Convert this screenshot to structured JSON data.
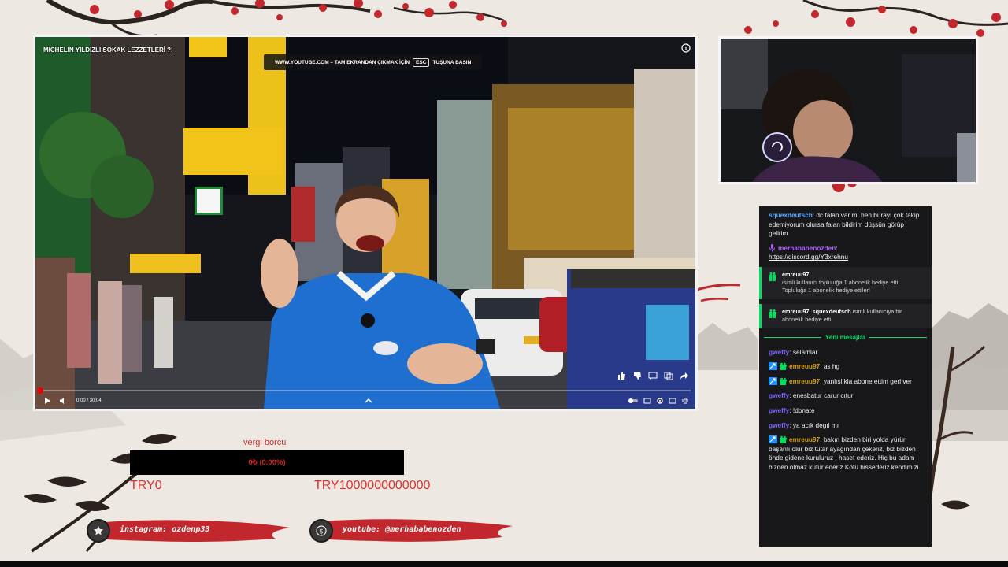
{
  "video": {
    "title": "MICHELIN YILDIZLI SOKAK LEZZETLERİ ?!",
    "fullscreen_notice": {
      "before": "WWW.YOUTUBE.COM – TAM EKRANDAN ÇIKMAK İÇİN",
      "key": "ESC",
      "after": "TUŞUNA BASIN"
    },
    "time": "0:00 / 30:04",
    "progress": 0.0
  },
  "chat": {
    "messages": [
      {
        "user": "squexdeutsch",
        "sep": ":",
        "text": " dc falan var mı ben burayı çok takip edemiyorum olursa falan bildirim düşsün görüp gelirim",
        "color": "#5aa8ff"
      },
      {
        "user": "merhababenozden",
        "sep": ":",
        "text": "https://discord.gg/Y3xrehnu",
        "color": "#b05cff",
        "badge": "mic-icon"
      }
    ],
    "gifts": [
      {
        "user": "emreuu97",
        "line1": "isimli kullanıcı topluluğa 1 abonelik hediye etti.",
        "line2": "Topluluğa 1 abonelik hediye ettiler!"
      },
      {
        "user": "emreuu97, squexdeutsch",
        "line1": " isimli kullanıcıya bir abonelik hediye etti"
      }
    ],
    "divider": "Yeni mesajlar",
    "new_messages": [
      {
        "user": "gweffy",
        "text": " selamlar",
        "color": "#7d63ff"
      },
      {
        "user": "emreuu97",
        "text": " as hg",
        "color": "#d6a000",
        "badges": true
      },
      {
        "user": "emreuu97",
        "text": " yanlıslıkla abone ettim geri ver",
        "color": "#d6a000",
        "badges": true
      },
      {
        "user": "gweffy",
        "text": " enesbatur carur cıtur",
        "color": "#7d63ff"
      },
      {
        "user": "gweffy",
        "text": " !donate",
        "color": "#7d63ff"
      },
      {
        "user": "gweffy",
        "text": " ya acık degıl mı",
        "color": "#7d63ff"
      },
      {
        "user": "emreuu97",
        "text": " bakın bizden biri yolda yürür başarılı olur biz tutar ayağından çekeriz, biz bizden önde gidene kuruluruz , haset ederiz. Hiç bu adam bizden olmaz küfür ederiz Kötü hissederiz kendimizi",
        "color": "#d6a000",
        "badges": true
      }
    ]
  },
  "goal": {
    "label": "vergi borcu",
    "percent_text": "0₺ (0.00%)",
    "min": "TRY0",
    "max": "TRY1000000000000",
    "progress": 0.0
  },
  "socials": {
    "instagram": "instagram: ozdenp33",
    "youtube": "youtube: @merhababenozden",
    "instagram_icon": "star-icon",
    "youtube_icon": "dollar-icon"
  },
  "colors": {
    "accent_red": "#d32c2c",
    "chat_bg": "#18181b",
    "gift_green": "#00e060"
  }
}
